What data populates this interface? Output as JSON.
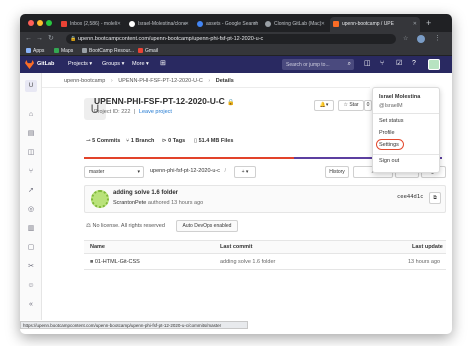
{
  "browser": {
    "tabs": [
      {
        "label": "Inbox (2,586) - moleli",
        "favicon_color": "#ea4335",
        "active": false
      },
      {
        "label": "Israel-Molestina/clone",
        "favicon_color": "#ffffff",
        "active": false
      },
      {
        "label": "assets - Google Search",
        "favicon_color": "#4285f4",
        "active": false
      },
      {
        "label": "Cloning GitLab (Mac)",
        "favicon_color": "#9aa0a6",
        "active": false
      },
      {
        "label": "upenn-bootcamp / UPE",
        "favicon_color": "#fc6d26",
        "active": true
      }
    ],
    "new_tab": "+",
    "url": "upenn.bootcampcontent.com/upenn-bootcamp/upenn-phi-fsf-pt-12-2020-u-c",
    "bookmarks": [
      {
        "label": "Apps",
        "color": "#8ab4f8"
      },
      {
        "label": "Maps",
        "color": "#34a853"
      },
      {
        "label": "BootCamp Resour...",
        "color": "#9aa0a6"
      },
      {
        "label": "Gmail",
        "color": "#ea4335"
      }
    ],
    "status_url": "https://upenn.bootcampcontent.com/upenn-bootcamp/upenn-phi-fsf-pt-12-2020-u-c/commits/master"
  },
  "gitlab": {
    "brand": "GitLab",
    "nav": [
      "Projects ▾",
      "Groups ▾",
      "More ▾"
    ],
    "search_placeholder": "Search or jump to...",
    "header_color": "#292961"
  },
  "breadcrumb": [
    "upenn-bootcamp",
    "UPENN-PHI-FSF-PT-12-2020-U-C",
    "Details"
  ],
  "project": {
    "initial": "U",
    "name": "UPENN-PHI-FSF-PT-12-2020-U-C",
    "id_text": "Project ID: 222",
    "leave_link": "Leave project",
    "stats": {
      "commits": "5 Commits",
      "branches": "1 Branch",
      "tags": "0 Tags",
      "files": "51.4 MB Files"
    },
    "notify_icon": "bell-icon",
    "star_label": "Star",
    "star_count": "0"
  },
  "repo": {
    "branch": "master",
    "path": "upenn-phi-fsf-pt-12-2020-u-c",
    "add_label": "+ ▾",
    "history_label": "History",
    "webide_label": "Web IDE"
  },
  "commit": {
    "message": "adding solve 1.6 folder",
    "author": "ScrantonPete",
    "authored": "authored 13 hours ago",
    "sha": "cee44d1c"
  },
  "license_text": "No license. All rights reserved",
  "autodevops_label": "Auto DevOps enabled",
  "table": {
    "headers": [
      "Name",
      "Last commit",
      "Last update"
    ],
    "rows": [
      {
        "name": "01-HTML-Git-CSS",
        "last_commit": "adding solve 1.6 folder",
        "last_update": "13 hours ago"
      }
    ]
  },
  "user_menu": {
    "name": "Israel Molestina",
    "handle": "@IsraelM",
    "items": [
      "Set status",
      "Profile",
      "Settings",
      "Sign out"
    ]
  }
}
